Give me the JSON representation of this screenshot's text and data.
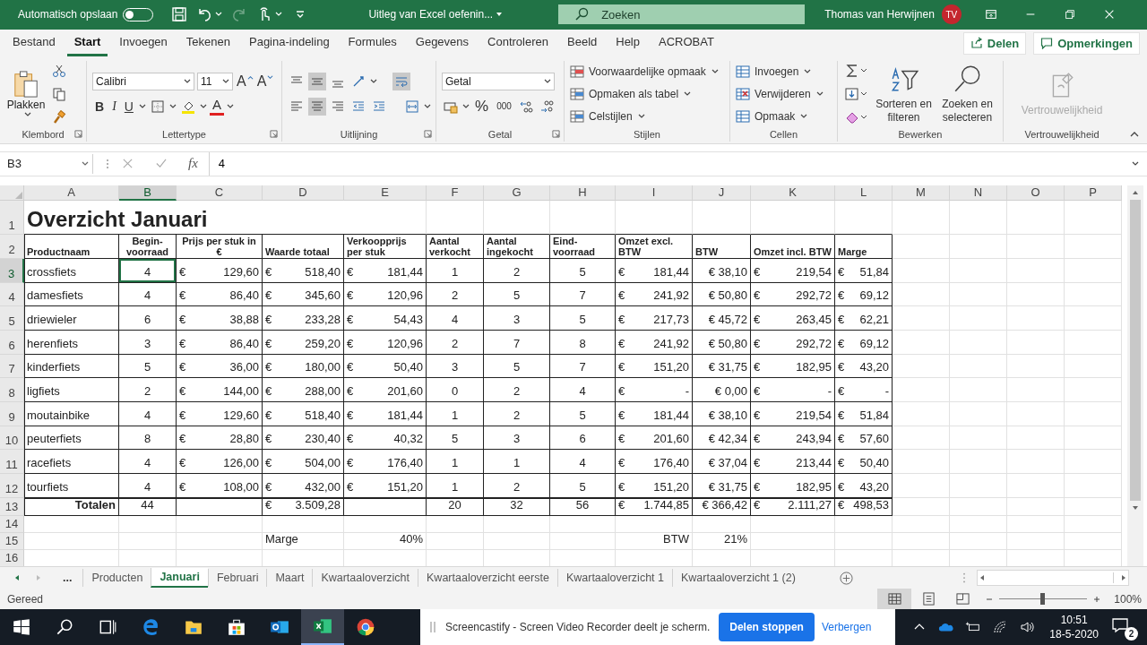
{
  "title_bar": {
    "autosave_label": "Automatisch opslaan",
    "autosave_on": false,
    "document": "Uitleg van Excel oefenin...",
    "search_placeholder": "Zoeken",
    "user": "Thomas van Herwijnen",
    "initials": "TV"
  },
  "menu_tabs": [
    {
      "label": "Bestand",
      "selected": false
    },
    {
      "label": "Start",
      "selected": true
    },
    {
      "label": "Invoegen",
      "selected": false
    },
    {
      "label": "Tekenen",
      "selected": false
    },
    {
      "label": "Pagina-indeling",
      "selected": false
    },
    {
      "label": "Formules",
      "selected": false
    },
    {
      "label": "Gegevens",
      "selected": false
    },
    {
      "label": "Controleren",
      "selected": false
    },
    {
      "label": "Beeld",
      "selected": false
    },
    {
      "label": "Help",
      "selected": false
    },
    {
      "label": "ACROBAT",
      "selected": false
    }
  ],
  "share_button": "Delen",
  "comments_button": "Opmerkingen",
  "ribbon": {
    "clipboard": {
      "paste": "Plakken",
      "label": "Klembord"
    },
    "font": {
      "family": "Calibri",
      "size": "11",
      "grow": "A",
      "shrink": "A",
      "bold": "B",
      "italic": "I",
      "underline": "U",
      "color_letter": "A",
      "label": "Lettertype"
    },
    "alignment": {
      "label": "Uitlijning"
    },
    "number": {
      "format": "Getal",
      "percent": "%",
      "thousands": "000",
      "label": "Getal"
    },
    "styles": {
      "items": [
        "Voorwaardelijke opmaak",
        "Opmaken als tabel",
        "Celstijlen"
      ],
      "label": "Stijlen"
    },
    "cells": {
      "items": [
        "Invoegen",
        "Verwijderen",
        "Opmaak"
      ],
      "label": "Cellen"
    },
    "editing": {
      "sort": "Sorteren en filteren",
      "find": "Zoeken en selecteren",
      "label": "Bewerken"
    },
    "sensitivity": {
      "button": "Vertrouwelijkheid",
      "disabled": true,
      "label": "Vertrouwelijkheid"
    }
  },
  "formula_bar": {
    "name_box": "B3",
    "fx": "fx",
    "value": "4"
  },
  "sheet": {
    "columns": [
      {
        "label": "A",
        "selected": false
      },
      {
        "label": "B",
        "selected": true
      },
      {
        "label": "C",
        "selected": false
      },
      {
        "label": "D",
        "selected": false
      },
      {
        "label": "E",
        "selected": false
      },
      {
        "label": "F",
        "selected": false
      },
      {
        "label": "G",
        "selected": false
      },
      {
        "label": "H",
        "selected": false
      },
      {
        "label": "I",
        "selected": false
      },
      {
        "label": "J",
        "selected": false
      },
      {
        "label": "K",
        "selected": false
      },
      {
        "label": "L",
        "selected": false
      },
      {
        "label": "M",
        "selected": false
      },
      {
        "label": "N",
        "selected": false
      },
      {
        "label": "O",
        "selected": false
      },
      {
        "label": "P",
        "selected": false
      }
    ],
    "rows": [
      {
        "num": "1",
        "kind": "title",
        "selected": false,
        "title": "Overzicht Januari"
      },
      {
        "num": "2",
        "kind": "header",
        "selected": false,
        "cells": [
          "Productnaam",
          "Begin-voorraad",
          "Prijs per stuk in €",
          "Waarde totaal",
          "Verkoopprijs per stuk",
          "Aantal verkocht",
          "Aantal ingekocht",
          "Eind-voorraad",
          "Omzet excl. BTW",
          "BTW",
          "Omzet incl. BTW",
          "Marge"
        ]
      },
      {
        "num": "3",
        "kind": "data",
        "selected": true,
        "cells": [
          "crossfiets",
          "4",
          {
            "cur": "€",
            "val": "129,60"
          },
          {
            "cur": "€",
            "val": "518,40"
          },
          {
            "cur": "€",
            "val": "181,44"
          },
          "1",
          "2",
          "5",
          {
            "cur": "€",
            "val": "181,44"
          },
          "€ 38,10",
          {
            "cur": "€",
            "val": "219,54"
          },
          {
            "cur": "€",
            "val": "51,84"
          }
        ]
      },
      {
        "num": "4",
        "kind": "data",
        "selected": false,
        "cells": [
          "damesfiets",
          "4",
          {
            "cur": "€",
            "val": "86,40"
          },
          {
            "cur": "€",
            "val": "345,60"
          },
          {
            "cur": "€",
            "val": "120,96"
          },
          "2",
          "5",
          "7",
          {
            "cur": "€",
            "val": "241,92"
          },
          "€ 50,80",
          {
            "cur": "€",
            "val": "292,72"
          },
          {
            "cur": "€",
            "val": "69,12"
          }
        ]
      },
      {
        "num": "5",
        "kind": "data",
        "selected": false,
        "cells": [
          "driewieler",
          "6",
          {
            "cur": "€",
            "val": "38,88"
          },
          {
            "cur": "€",
            "val": "233,28"
          },
          {
            "cur": "€",
            "val": "54,43"
          },
          "4",
          "3",
          "5",
          {
            "cur": "€",
            "val": "217,73"
          },
          "€ 45,72",
          {
            "cur": "€",
            "val": "263,45"
          },
          {
            "cur": "€",
            "val": "62,21"
          }
        ]
      },
      {
        "num": "6",
        "kind": "data",
        "selected": false,
        "cells": [
          "herenfiets",
          "3",
          {
            "cur": "€",
            "val": "86,40"
          },
          {
            "cur": "€",
            "val": "259,20"
          },
          {
            "cur": "€",
            "val": "120,96"
          },
          "2",
          "7",
          "8",
          {
            "cur": "€",
            "val": "241,92"
          },
          "€ 50,80",
          {
            "cur": "€",
            "val": "292,72"
          },
          {
            "cur": "€",
            "val": "69,12"
          }
        ]
      },
      {
        "num": "7",
        "kind": "data",
        "selected": false,
        "cells": [
          "kinderfiets",
          "5",
          {
            "cur": "€",
            "val": "36,00"
          },
          {
            "cur": "€",
            "val": "180,00"
          },
          {
            "cur": "€",
            "val": "50,40"
          },
          "3",
          "5",
          "7",
          {
            "cur": "€",
            "val": "151,20"
          },
          "€ 31,75",
          {
            "cur": "€",
            "val": "182,95"
          },
          {
            "cur": "€",
            "val": "43,20"
          }
        ]
      },
      {
        "num": "8",
        "kind": "data",
        "selected": false,
        "cells": [
          "ligfiets",
          "2",
          {
            "cur": "€",
            "val": "144,00"
          },
          {
            "cur": "€",
            "val": "288,00"
          },
          {
            "cur": "€",
            "val": "201,60"
          },
          "0",
          "2",
          "4",
          {
            "cur": "€",
            "val": "-"
          },
          "€ 0,00",
          {
            "cur": "€",
            "val": "-"
          },
          {
            "cur": "€",
            "val": "-"
          }
        ]
      },
      {
        "num": "9",
        "kind": "data",
        "selected": false,
        "cells": [
          "moutainbike",
          "4",
          {
            "cur": "€",
            "val": "129,60"
          },
          {
            "cur": "€",
            "val": "518,40"
          },
          {
            "cur": "€",
            "val": "181,44"
          },
          "1",
          "2",
          "5",
          {
            "cur": "€",
            "val": "181,44"
          },
          "€ 38,10",
          {
            "cur": "€",
            "val": "219,54"
          },
          {
            "cur": "€",
            "val": "51,84"
          }
        ]
      },
      {
        "num": "10",
        "kind": "data",
        "selected": false,
        "cells": [
          "peuterfiets",
          "8",
          {
            "cur": "€",
            "val": "28,80"
          },
          {
            "cur": "€",
            "val": "230,40"
          },
          {
            "cur": "€",
            "val": "40,32"
          },
          "5",
          "3",
          "6",
          {
            "cur": "€",
            "val": "201,60"
          },
          "€ 42,34",
          {
            "cur": "€",
            "val": "243,94"
          },
          {
            "cur": "€",
            "val": "57,60"
          }
        ]
      },
      {
        "num": "11",
        "kind": "data",
        "selected": false,
        "cells": [
          "racefiets",
          "4",
          {
            "cur": "€",
            "val": "126,00"
          },
          {
            "cur": "€",
            "val": "504,00"
          },
          {
            "cur": "€",
            "val": "176,40"
          },
          "1",
          "1",
          "4",
          {
            "cur": "€",
            "val": "176,40"
          },
          "€ 37,04",
          {
            "cur": "€",
            "val": "213,44"
          },
          {
            "cur": "€",
            "val": "50,40"
          }
        ]
      },
      {
        "num": "12",
        "kind": "data",
        "selected": false,
        "cells": [
          "tourfiets",
          "4",
          {
            "cur": "€",
            "val": "108,00"
          },
          {
            "cur": "€",
            "val": "432,00"
          },
          {
            "cur": "€",
            "val": "151,20"
          },
          "1",
          "2",
          "5",
          {
            "cur": "€",
            "val": "151,20"
          },
          "€ 31,75",
          {
            "cur": "€",
            "val": "182,95"
          },
          {
            "cur": "€",
            "val": "43,20"
          }
        ]
      },
      {
        "num": "13",
        "kind": "total",
        "selected": false,
        "cells": [
          "Totalen",
          "44",
          null,
          {
            "cur": "€",
            "val": "3.509,28"
          },
          null,
          "20",
          "32",
          "56",
          {
            "cur": "€",
            "val": "1.744,85"
          },
          "€ 366,42",
          {
            "cur": "€",
            "val": "2.111,27"
          },
          {
            "cur": "€",
            "val": "498,53"
          }
        ]
      },
      {
        "num": "14",
        "kind": "blank",
        "selected": false,
        "cells": []
      },
      {
        "num": "15",
        "kind": "note",
        "selected": false,
        "cells": [
          null,
          null,
          null,
          "Marge",
          "40%",
          null,
          null,
          null,
          "BTW",
          "21%"
        ]
      },
      {
        "num": "16",
        "kind": "blank",
        "selected": false,
        "cells": []
      }
    ]
  },
  "sheet_tabs": {
    "overflow": "...",
    "tabs": [
      {
        "label": "Producten",
        "selected": false
      },
      {
        "label": "Januari",
        "selected": true
      },
      {
        "label": "Februari",
        "selected": false
      },
      {
        "label": "Maart",
        "selected": false
      },
      {
        "label": "Kwartaaloverzicht",
        "selected": false
      },
      {
        "label": "Kwartaaloverzicht eerste",
        "selected": false
      },
      {
        "label": "Kwartaaloverzicht 1",
        "selected": false
      },
      {
        "label": "Kwartaaloverzicht 1 (2)",
        "selected": false
      }
    ]
  },
  "status_bar": {
    "status": "Gereed",
    "views": [
      {
        "kind": "normal",
        "selected": true
      },
      {
        "kind": "page_layout",
        "selected": false
      },
      {
        "kind": "page_break",
        "selected": false
      }
    ],
    "zoom": {
      "level": 0.5,
      "reading": "100%"
    }
  },
  "taskbar": {
    "apps": [
      {
        "kind": "start",
        "selected": false
      },
      {
        "kind": "search",
        "selected": false
      },
      {
        "kind": "taskview",
        "selected": false
      },
      {
        "kind": "edge",
        "selected": false
      },
      {
        "kind": "explorer",
        "selected": false
      },
      {
        "kind": "store",
        "selected": false
      },
      {
        "kind": "outlook",
        "selected": false
      },
      {
        "kind": "excel",
        "selected": true
      },
      {
        "kind": "chrome",
        "selected": false
      }
    ],
    "sharing_bar": {
      "message": "Screencastify - Screen Video Recorder deelt je scherm.",
      "stop": "Delen stoppen",
      "hide": "Verbergen"
    },
    "time": "10:51",
    "date": "18-5-2020",
    "notifications": "2"
  }
}
